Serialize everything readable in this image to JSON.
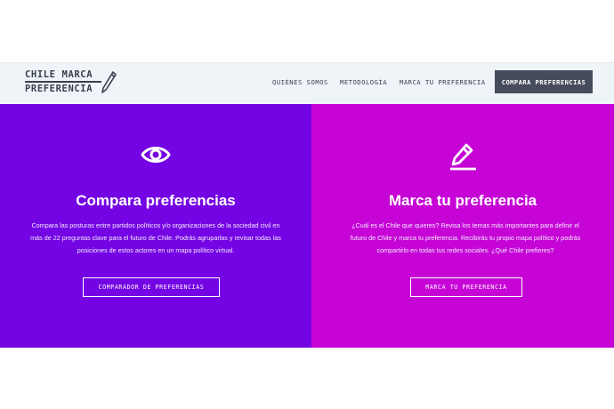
{
  "header": {
    "logo_line1": "CHILE MARCA",
    "logo_line2": "PREFERENCIA",
    "nav": {
      "about": "QUIÉNES SOMOS",
      "methodology": "METODOLOGÍA",
      "mark": "MARCA TU PREFERENCIA",
      "compare": "COMPARA PREFERENCIAS"
    }
  },
  "colors": {
    "left_panel": "#7404e4",
    "right_panel": "#c604d6",
    "header_bg": "#eef4f8",
    "cta_bg": "#464c5e"
  },
  "compare": {
    "icon": "eye-icon",
    "title": "Compara preferencias",
    "body": "Compara las posturas entre partidos políticos y/o organizaciones de la sociedad civil en más de 22 preguntas clave para el futuro de Chile. Podrás agruparlas y revisar todas las posiciones de estos actores en un mapa político virtual.",
    "button": "COMPARADOR DE PREFERENCIAS"
  },
  "mark": {
    "icon": "pencil-icon",
    "title": "Marca tu preferencia",
    "body": "¿Cuál es el Chile que quieres? Revisa los temas más importantes para definir el futuro de Chile y marca tu preferencia. Recibirás tu propio mapa político y podrás compartirlo en todas tus redes sociales. ¿Qué Chile prefieres?",
    "button": "MARCA TU PREFERENCIA"
  }
}
